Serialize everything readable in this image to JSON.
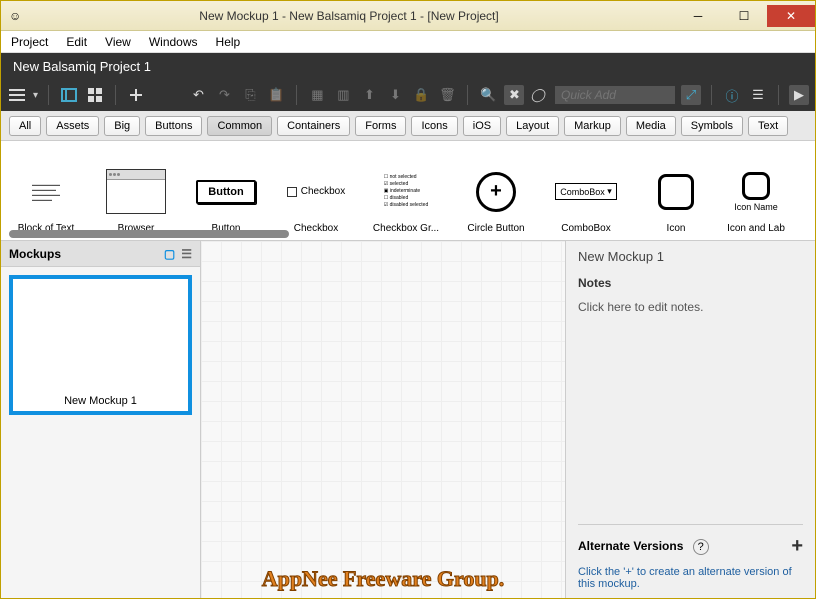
{
  "window": {
    "title": "New Mockup 1 - New Balsamiq Project 1 - [New Project]"
  },
  "menu": {
    "items": [
      "Project",
      "Edit",
      "View",
      "Windows",
      "Help"
    ]
  },
  "project": {
    "name": "New Balsamiq Project 1"
  },
  "quickadd": {
    "placeholder": "Quick Add"
  },
  "categories": {
    "items": [
      "All",
      "Assets",
      "Big",
      "Buttons",
      "Common",
      "Containers",
      "Forms",
      "Icons",
      "iOS",
      "Layout",
      "Markup",
      "Media",
      "Symbols",
      "Text"
    ],
    "active": "Common"
  },
  "library": {
    "items": [
      {
        "name": "Block of Text"
      },
      {
        "name": "Browser"
      },
      {
        "name": "Button",
        "sample": "Button"
      },
      {
        "name": "Checkbox",
        "sample": "Checkbox"
      },
      {
        "name": "Checkbox Gr..."
      },
      {
        "name": "Circle Button"
      },
      {
        "name": "ComboBox",
        "sample": "ComboBox"
      },
      {
        "name": "Icon"
      },
      {
        "name": "Icon and Lab",
        "sub": "Icon Name"
      }
    ]
  },
  "sidebar": {
    "title": "Mockups",
    "mockup_name": "New Mockup 1"
  },
  "rightpanel": {
    "mockup_title": "New Mockup 1",
    "notes_label": "Notes",
    "notes_placeholder": "Click here to edit notes.",
    "alt_title": "Alternate Versions",
    "alt_desc": "Click the '+' to create an alternate version of this mockup."
  },
  "watermark": "AppNee Freeware Group."
}
